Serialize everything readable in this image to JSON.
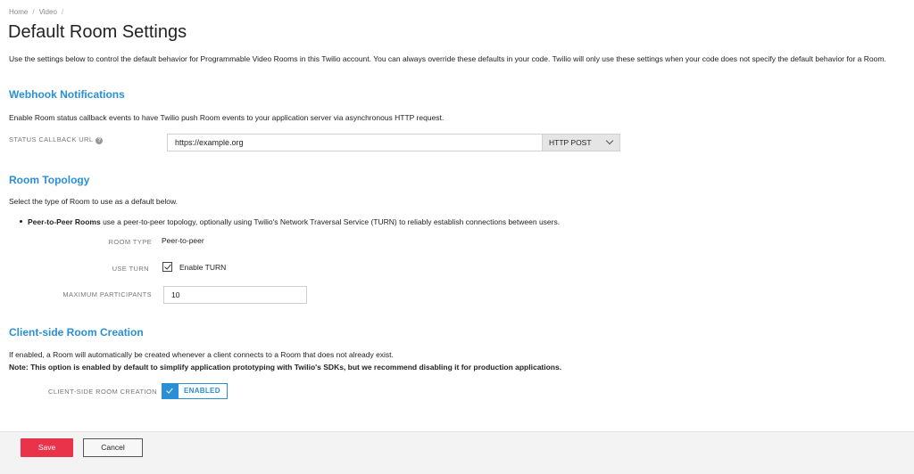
{
  "breadcrumb": {
    "items": [
      "Home",
      "Video"
    ],
    "separator": "/"
  },
  "page": {
    "title": "Default Room Settings",
    "intro": "Use the settings below to control the default behavior for Programmable Video Rooms in this Twilio account. You can always override these defaults in your code. Twilio will only use these settings when your code does not specify the default behavior for a Room."
  },
  "webhook": {
    "title": "Webhook Notifications",
    "description": "Enable Room status callback events to have Twilio push Room events to your application server via asynchronous HTTP request.",
    "callback_label": "STATUS CALLBACK URL",
    "help_icon": "?",
    "callback_value": "https://example.org",
    "method_value": "HTTP POST"
  },
  "topology": {
    "title": "Room Topology",
    "description": "Select the type of Room to use as a default below.",
    "bullet_bold": "Peer-to-Peer Rooms",
    "bullet_text": " use a peer-to-peer topology, optionally using Twilio's Network Traversal Service (TURN) to reliably establish connections between users.",
    "room_type_label": "ROOM TYPE",
    "room_type_value": "Peer-to-peer",
    "use_turn_label": "USE TURN",
    "enable_turn_label": "Enable TURN",
    "enable_turn_checked": true,
    "max_participants_label": "MAXIMUM PARTICIPANTS",
    "max_participants_value": "10"
  },
  "client_side": {
    "title": "Client-side Room Creation",
    "description": "If enabled, a Room will automatically be created whenever a client connects to a Room that does not already exist.",
    "note": "Note: This option is enabled by default to simplify application prototyping with Twilio's SDKs, but we recommend disabling it for production applications.",
    "label": "CLIENT-SIDE ROOM CREATION",
    "toggle_label": "ENABLED",
    "enabled": true
  },
  "footer": {
    "save_label": "Save",
    "cancel_label": "Cancel"
  },
  "colors": {
    "accent": "#2a8fd6",
    "save": "#e8334a"
  }
}
